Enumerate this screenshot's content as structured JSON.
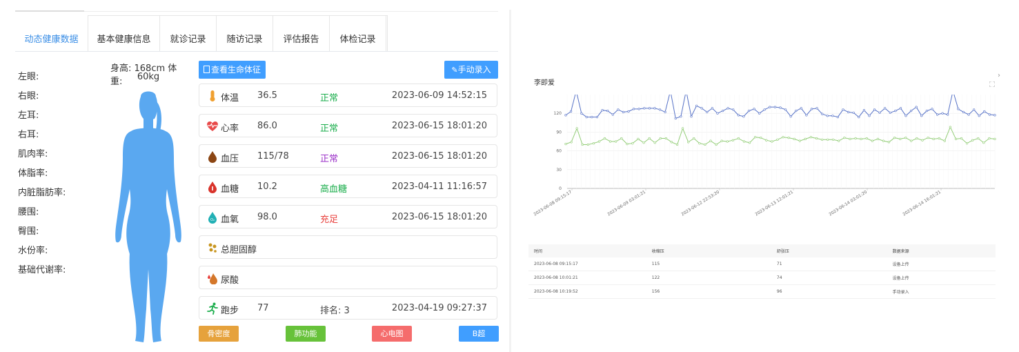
{
  "tabs": [
    "动态健康数据",
    "基本健康信息",
    "就诊记录",
    "随访记录",
    "评估报告",
    "体检记录"
  ],
  "active_tab": 0,
  "metrics_left": [
    "左眼:",
    "右眼:",
    "左耳:",
    "右耳:",
    "肌肉率:",
    "体脂率:",
    "内脏脂肪率:",
    "腰围:",
    "臀围:",
    "水份率:",
    "基础代谢率:"
  ],
  "body_info": {
    "line1": "身高: 168cm 体重:",
    "line2": "60kg"
  },
  "buttons": {
    "view_vitals": "查看生命体征",
    "manual_entry": "手动录入"
  },
  "cards": [
    {
      "icon": "thermometer-icon",
      "name": "体温",
      "value": "36.5",
      "status": "正常",
      "status_color": "#1aad4b",
      "time": "2023-06-09 14:52:15"
    },
    {
      "icon": "heart-rate-icon",
      "name": "心率",
      "value": "86.0",
      "status": "正常",
      "status_color": "#1aad4b",
      "time": "2023-06-15 18:01:20"
    },
    {
      "icon": "blood-pressure-icon",
      "name": "血压",
      "value": "115/78",
      "status": "正常",
      "status_color": "#9b30c8",
      "time": "2023-06-15 18:01:20"
    },
    {
      "icon": "blood-sugar-icon",
      "name": "血糖",
      "value": "10.2",
      "status": "高血糖",
      "status_color": "#1aad4b",
      "time": "2023-04-11 11:16:57"
    },
    {
      "icon": "blood-oxygen-icon",
      "name": "血氧",
      "value": "98.0",
      "status": "充足",
      "status_color": "#e8413d",
      "time": "2023-06-15 18:01:20"
    },
    {
      "icon": "cholesterol-icon",
      "name": "总胆固醇",
      "value": "",
      "status": "",
      "status_color": "#333333",
      "time": ""
    },
    {
      "icon": "uric-acid-icon",
      "name": "尿酸",
      "value": "",
      "status": "",
      "status_color": "#333333",
      "time": ""
    },
    {
      "icon": "running-icon",
      "name": "跑步",
      "value": "77",
      "status": "排名: 3",
      "status_color": "#444444",
      "time": "2023-04-19 09:27:37"
    }
  ],
  "bottom_buttons": [
    {
      "label": "骨密度",
      "color": "#e6a23c"
    },
    {
      "label": "肺功能",
      "color": "#67c23a"
    },
    {
      "label": "心电图",
      "color": "#f56c6c"
    },
    {
      "label": "B超",
      "color": "#409eff"
    }
  ],
  "chart_title": "李即爱",
  "chart_data": {
    "type": "line",
    "ylim": [
      0,
      150
    ],
    "yticks": [
      0,
      30,
      60,
      90,
      120
    ],
    "x_tick_labels": [
      "2023-06-08 09:15:17",
      "2023-06-09 03:01:21",
      "2023-06-12 22:53:20",
      "2023-06-13 12:01:21",
      "2023-06-14 03:01:20",
      "2023-06-14 16:01:21"
    ],
    "grid": true,
    "series": [
      {
        "color": "#5470c6",
        "values": [
          117,
          123,
          156,
          120,
          114,
          114,
          114,
          125,
          124,
          118,
          126,
          122,
          123,
          127,
          127,
          128,
          128,
          128,
          126,
          122,
          156,
          112,
          115,
          156,
          115,
          132,
          128,
          122,
          128,
          120,
          124,
          128,
          126,
          117,
          115,
          124,
          127,
          120,
          126,
          130,
          130,
          129,
          126,
          115,
          124,
          128,
          117,
          127,
          128,
          119,
          116,
          116,
          114,
          126,
          122,
          121,
          114,
          125,
          116,
          126,
          121,
          128,
          121,
          124,
          128,
          116,
          124,
          130,
          116,
          124,
          127,
          118,
          120,
          118,
          156,
          127,
          122,
          118,
          126,
          116,
          123,
          118,
          117
        ]
      },
      {
        "color": "#91cc75",
        "values": [
          71,
          74,
          96,
          70,
          70,
          72,
          75,
          80,
          75,
          75,
          80,
          71,
          72,
          79,
          73,
          80,
          73,
          80,
          80,
          74,
          70,
          96,
          74,
          80,
          72,
          70,
          76,
          70,
          76,
          75,
          77,
          80,
          75,
          73,
          82,
          81,
          77,
          75,
          78,
          82,
          81,
          79,
          76,
          79,
          82,
          80,
          78,
          78,
          78,
          76,
          81,
          79,
          80,
          79,
          80,
          76,
          79,
          76,
          74,
          81,
          79,
          81,
          76,
          80,
          77,
          81,
          79,
          80,
          76,
          98,
          79,
          80,
          72,
          77,
          80,
          73,
          80,
          79
        ]
      }
    ]
  },
  "table": {
    "headers": [
      "时间",
      "收缩压",
      "舒张压",
      "数据来源"
    ],
    "rows": [
      [
        "2023-06-08 09:15:17",
        "115",
        "71",
        "设备上传"
      ],
      [
        "2023-06-08 10:01:21",
        "122",
        "74",
        "设备上传"
      ],
      [
        "2023-06-08 10:19:52",
        "156",
        "96",
        "手动录入"
      ]
    ]
  }
}
